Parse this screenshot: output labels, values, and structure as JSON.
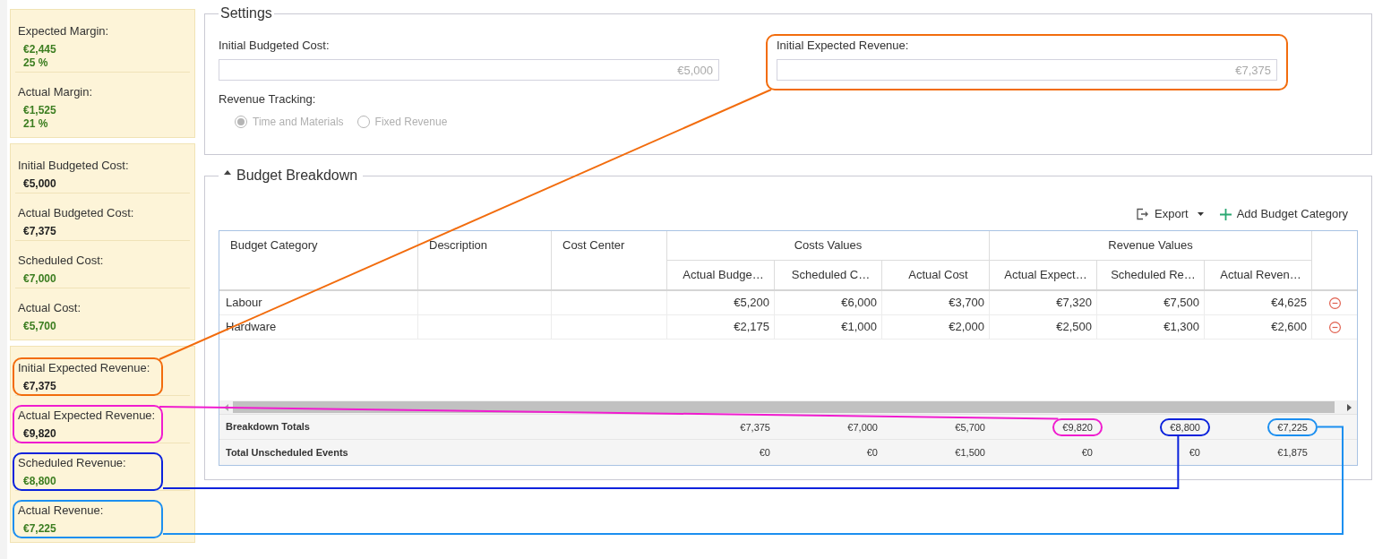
{
  "sidebar": {
    "panels": [
      {
        "items": [
          {
            "label": "Expected Margin:",
            "values": [
              "€2,445",
              "25 %"
            ],
            "accent": true
          },
          {
            "label": "Actual Margin:",
            "values": [
              "€1,525",
              "21 %"
            ],
            "accent": true
          }
        ]
      },
      {
        "items": [
          {
            "label": "Initial Budgeted Cost:",
            "values": [
              "€5,000"
            ],
            "accent": false
          },
          {
            "label": "Actual Budgeted Cost:",
            "values": [
              "€7,375"
            ],
            "accent": false
          },
          {
            "label": "Scheduled Cost:",
            "values": [
              "€7,000"
            ],
            "accent": true
          },
          {
            "label": "Actual Cost:",
            "values": [
              "€5,700"
            ],
            "accent": true
          }
        ]
      },
      {
        "items": [
          {
            "label": "Initial Expected Revenue:",
            "values": [
              "€7,375"
            ],
            "accent": false,
            "highlight": {
              "color": "#f26c0d",
              "kind": "straight"
            }
          },
          {
            "label": "Actual Expected Revenue:",
            "values": [
              "€9,820"
            ],
            "accent": false,
            "highlight": {
              "color": "#f01ccf",
              "kind": "straight"
            }
          },
          {
            "label": "Scheduled Revenue:",
            "values": [
              "€8,800"
            ],
            "accent": true,
            "highlight": {
              "color": "#0a22dc",
              "kind": "under"
            }
          },
          {
            "label": "Actual Revenue:",
            "values": [
              "€7,225"
            ],
            "accent": true,
            "highlight": {
              "color": "#1c8ff0",
              "kind": "around"
            }
          }
        ]
      }
    ]
  },
  "settings": {
    "title": "Settings",
    "fields": [
      {
        "label": "Initial Budgeted Cost:",
        "value": "€5,000",
        "disabled": true
      },
      {
        "label": "Initial Expected Revenue:",
        "value": "€7,375",
        "disabled": true,
        "highlight": {
          "color": "#f26c0d"
        }
      }
    ],
    "revenue_tracking": {
      "label": "Revenue Tracking:",
      "disabled": true,
      "options": [
        {
          "label": "Time and Materials",
          "selected": true
        },
        {
          "label": "Fixed Revenue",
          "selected": false
        }
      ]
    }
  },
  "budget_breakdown": {
    "title": "Budget Breakdown",
    "expanded": true,
    "toolbar": [
      {
        "kind": "export",
        "label": "Export"
      },
      {
        "kind": "add",
        "label": "Add Budget Category"
      }
    ],
    "table": {
      "columns": [
        {
          "label": "Budget Category"
        },
        {
          "label": "Description"
        },
        {
          "label": "Cost Center"
        }
      ],
      "column_groups": [
        {
          "label": "Costs Values",
          "columns": [
            "Actual Budge…",
            "Scheduled C…",
            "Actual Cost"
          ]
        },
        {
          "label": "Revenue Values",
          "columns": [
            "Actual Expect…",
            "Scheduled Re…",
            "Actual Reven…"
          ]
        }
      ],
      "rows": [
        {
          "category": "Labour",
          "values": [
            "€5,200",
            "€6,000",
            "€3,700",
            "€7,320",
            "€7,500",
            "€4,625"
          ]
        },
        {
          "category": "Hardware",
          "values": [
            "€2,175",
            "€1,000",
            "€2,000",
            "€2,500",
            "€1,300",
            "€2,600"
          ]
        }
      ],
      "footer_rows": [
        {
          "label": "Breakdown Totals",
          "values": [
            {
              "text": "€7,375"
            },
            {
              "text": "€7,000"
            },
            {
              "text": "€5,700"
            },
            {
              "text": "€9,820",
              "highlight": {
                "color": "#f01ccf"
              }
            },
            {
              "text": "€8,800",
              "highlight": {
                "color": "#0a22dc"
              }
            },
            {
              "text": "€7,225",
              "highlight": {
                "color": "#1c8ff0"
              }
            }
          ]
        },
        {
          "label": "Total Unscheduled Events",
          "values": [
            {
              "text": "€0"
            },
            {
              "text": "€0"
            },
            {
              "text": "€1,500"
            },
            {
              "text": "€0"
            },
            {
              "text": "€0"
            },
            {
              "text": "€1,875"
            }
          ]
        }
      ]
    }
  }
}
